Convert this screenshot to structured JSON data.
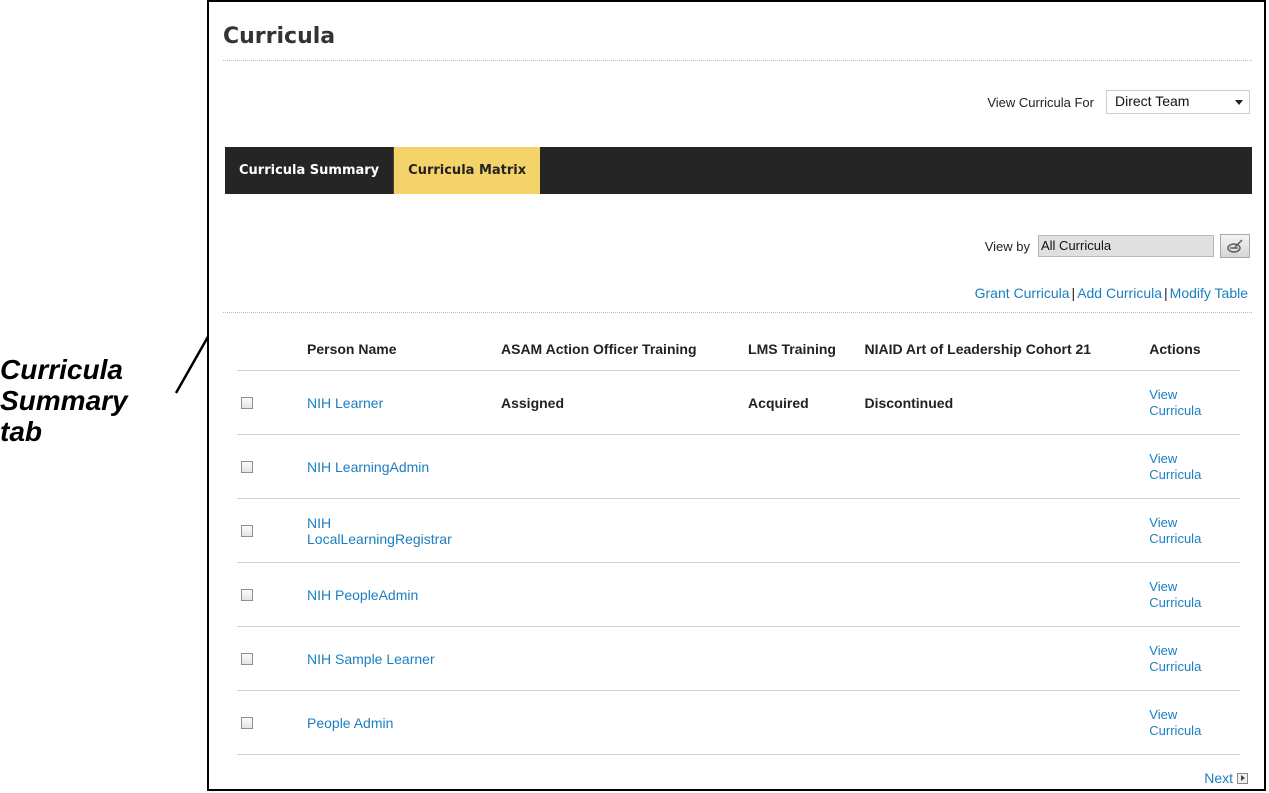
{
  "callout": {
    "lines": [
      "Curricula",
      "Summary",
      "tab"
    ]
  },
  "page": {
    "title": "Curricula"
  },
  "view_for": {
    "label": "View Curricula For",
    "selected": "Direct Team"
  },
  "tabs": [
    {
      "label": "Curricula Summary",
      "active": false
    },
    {
      "label": "Curricula Matrix",
      "active": true
    }
  ],
  "view_by": {
    "label": "View by",
    "value": "All Curricula"
  },
  "links": {
    "grant": "Grant Curricula",
    "add": "Add Curricula",
    "modify": "Modify Table"
  },
  "table": {
    "headers": [
      "Person Name",
      "ASAM Action Officer Training",
      "LMS Training",
      "NIAID Art of Leadership Cohort 21",
      "Actions"
    ],
    "rows": [
      {
        "name": "NIH Learner",
        "c1": "Assigned",
        "c2": "Acquired",
        "c3": "Discontinued",
        "action": "View Curricula"
      },
      {
        "name": "NIH LearningAdmin",
        "c1": "",
        "c2": "",
        "c3": "",
        "action": "View Curricula"
      },
      {
        "name": "NIH LocalLearningRegistrar",
        "c1": "",
        "c2": "",
        "c3": "",
        "action": "View Curricula"
      },
      {
        "name": "NIH PeopleAdmin",
        "c1": "",
        "c2": "",
        "c3": "",
        "action": "View Curricula"
      },
      {
        "name": "NIH Sample Learner",
        "c1": "",
        "c2": "",
        "c3": "",
        "action": "View Curricula"
      },
      {
        "name": "People Admin",
        "c1": "",
        "c2": "",
        "c3": "",
        "action": "View Curricula"
      }
    ]
  },
  "pagination": {
    "next": "Next"
  },
  "colors": {
    "tab_bar": "#252525",
    "active_tab": "#f5d36b",
    "link": "#1a7fbf"
  }
}
